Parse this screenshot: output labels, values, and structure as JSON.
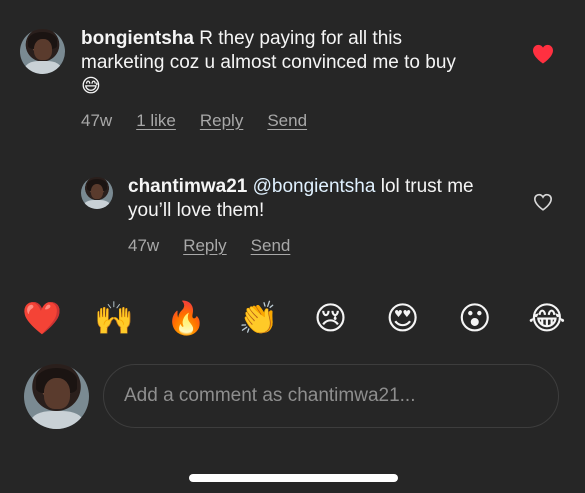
{
  "comments": [
    {
      "username": "bongientsha",
      "text": " R they paying for all this marketing coz u almost convinced me to buy😅",
      "time": "47w",
      "likes": "1 like",
      "reply": "Reply",
      "send": "Send",
      "liked": true
    },
    {
      "username": "chantimwa21",
      "mention": "@bongientsha",
      "text": " lol trust me you’ll love them!",
      "time": "47w",
      "reply": "Reply",
      "send": "Send",
      "liked": false
    }
  ],
  "reactions": [
    "❤️",
    "🙌",
    "🔥",
    "👏",
    "😢",
    "😍",
    "😮",
    "😂"
  ],
  "composer": {
    "placeholder": "Add a comment as chantimwa21..."
  },
  "colors": {
    "background": "#262626",
    "heart_red": "#ff3040",
    "meta_gray": "#a8a8a8"
  },
  "icons": {
    "liked": "heart-filled-icon",
    "unliked": "heart-outline-icon"
  }
}
